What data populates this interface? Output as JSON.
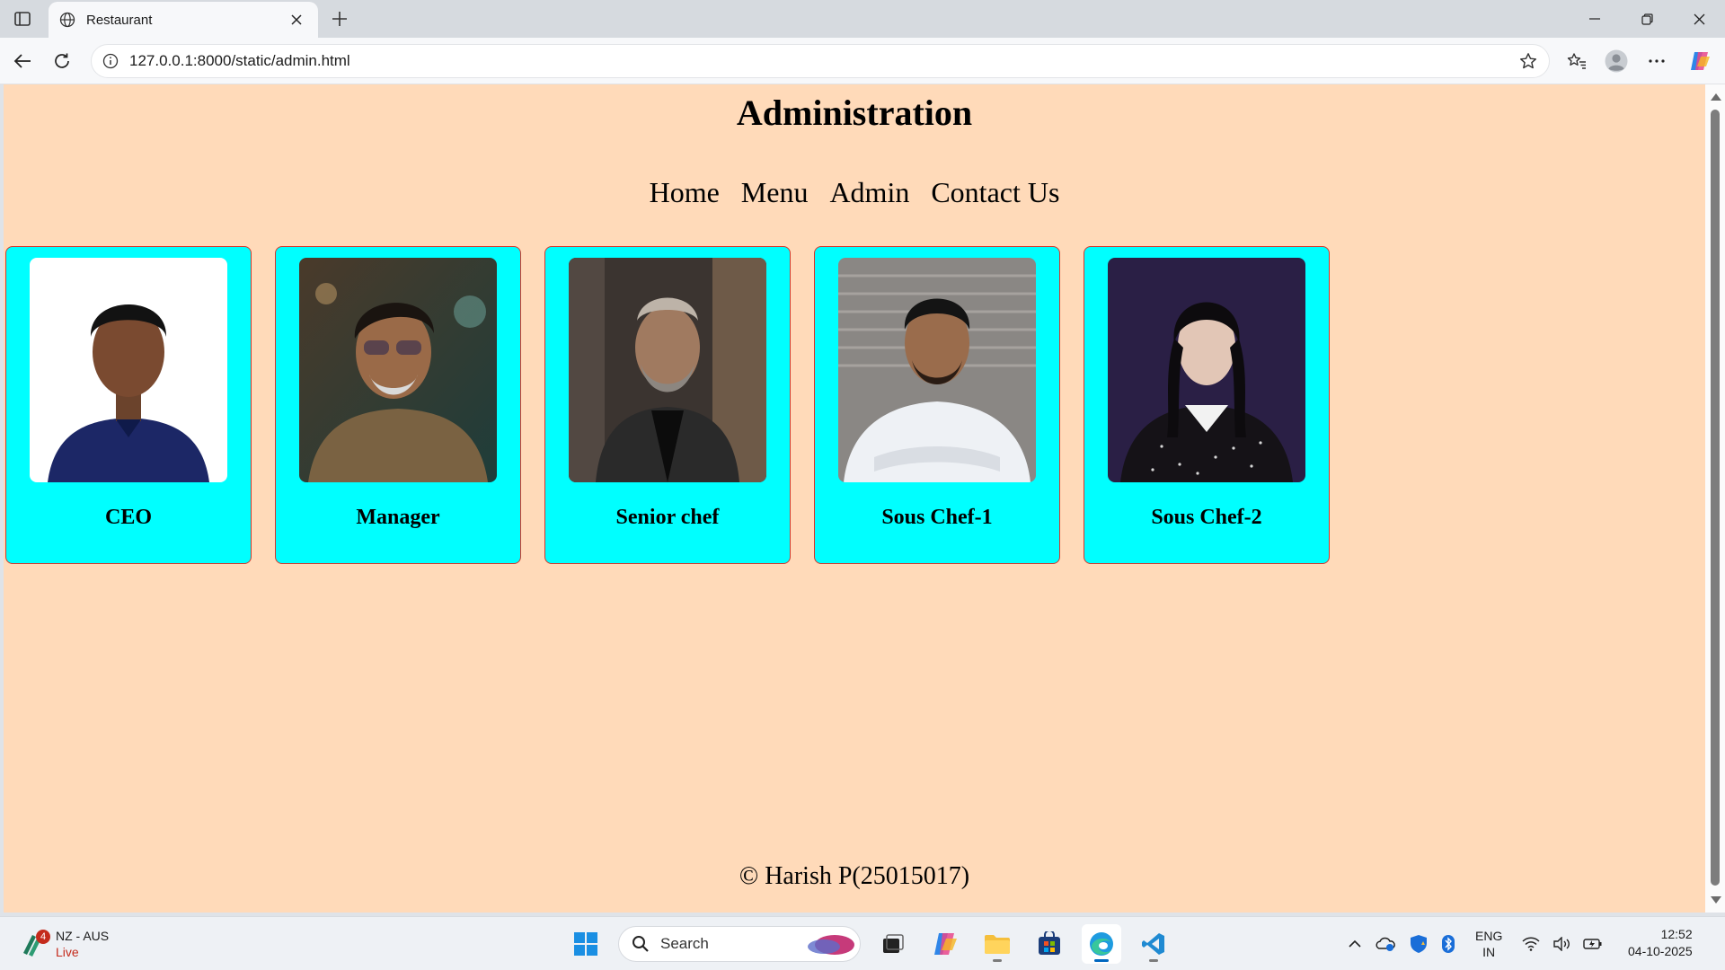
{
  "browser": {
    "tab_title": "Restaurant",
    "url": "127.0.0.1:8000/static/admin.html"
  },
  "page": {
    "title": "Administration",
    "nav": [
      "Home",
      "Menu",
      "Admin",
      "Contact Us"
    ],
    "cards": [
      {
        "role": "CEO"
      },
      {
        "role": "Manager"
      },
      {
        "role": "Senior chef"
      },
      {
        "role": "Sous Chef-1"
      },
      {
        "role": "Sous Chef-2"
      }
    ],
    "footer": "© Harish P(25015017)",
    "colors": {
      "background": "#ffdab9",
      "card_background": "#00ffff",
      "card_border": "#d4372b"
    }
  },
  "taskbar": {
    "weather_badge": "4",
    "weather_title": "NZ - AUS",
    "weather_status": "Live",
    "search_label": "Search",
    "lang_line1": "ENG",
    "lang_line2": "IN",
    "time": "12:52",
    "date": "04-10-2025"
  }
}
